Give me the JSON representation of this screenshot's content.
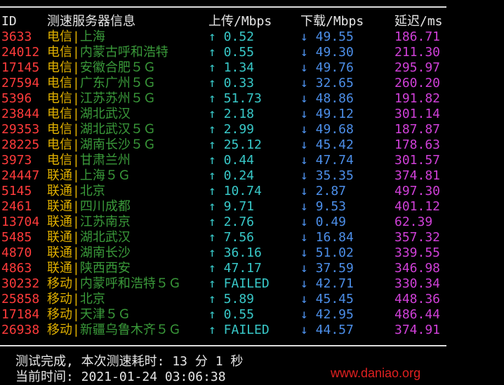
{
  "header": {
    "id": "ID",
    "server": "测速服务器信息",
    "upload": "上传/Mbps",
    "download": "下载/Mbps",
    "latency": "延迟/ms"
  },
  "rows": [
    {
      "id": "3633",
      "isp": "电信",
      "loc": "上海",
      "up": "↑ 0.52",
      "down": "↓ 49.55",
      "ping": "186.71"
    },
    {
      "id": "24012",
      "isp": "电信",
      "loc": "内蒙古呼和浩特",
      "up": "↑ 0.55",
      "down": "↓ 49.30",
      "ping": "211.30"
    },
    {
      "id": "17145",
      "isp": "电信",
      "loc": "安徽合肥５Ｇ",
      "up": "↑ 1.34",
      "down": "↓ 49.76",
      "ping": "295.97"
    },
    {
      "id": "27594",
      "isp": "电信",
      "loc": "广东广州５Ｇ",
      "up": "↑ 0.33",
      "down": "↓ 32.65",
      "ping": "260.20"
    },
    {
      "id": "5396",
      "isp": "电信",
      "loc": "江苏苏州５Ｇ",
      "up": "↑ 51.73",
      "down": "↓ 48.86",
      "ping": "191.82"
    },
    {
      "id": "23844",
      "isp": "电信",
      "loc": "湖北武汉",
      "up": "↑ 2.18",
      "down": "↓ 49.12",
      "ping": "301.14"
    },
    {
      "id": "29353",
      "isp": "电信",
      "loc": "湖北武汉５Ｇ",
      "up": "↑ 2.99",
      "down": "↓ 49.68",
      "ping": "187.87"
    },
    {
      "id": "28225",
      "isp": "电信",
      "loc": "湖南长沙５Ｇ",
      "up": "↑ 25.12",
      "down": "↓ 45.42",
      "ping": "178.63"
    },
    {
      "id": "3973",
      "isp": "电信",
      "loc": "甘肃兰州",
      "up": "↑ 0.44",
      "down": "↓ 47.74",
      "ping": "301.57"
    },
    {
      "id": "24447",
      "isp": "联通",
      "loc": "上海５Ｇ",
      "up": "↑ 0.24",
      "down": "↓ 35.35",
      "ping": "374.81"
    },
    {
      "id": "5145",
      "isp": "联通",
      "loc": "北京",
      "up": "↑ 10.74",
      "down": "↓ 2.87",
      "ping": "497.30"
    },
    {
      "id": "2461",
      "isp": "联通",
      "loc": "四川成都",
      "up": "↑ 9.71",
      "down": "↓ 9.53",
      "ping": "401.12"
    },
    {
      "id": "13704",
      "isp": "联通",
      "loc": "江苏南京",
      "up": "↑ 2.76",
      "down": "↓ 0.49",
      "ping": "62.39"
    },
    {
      "id": "5485",
      "isp": "联通",
      "loc": "湖北武汉",
      "up": "↑ 7.56",
      "down": "↓ 16.84",
      "ping": "357.32"
    },
    {
      "id": "4870",
      "isp": "联通",
      "loc": "湖南长沙",
      "up": "↑ 36.16",
      "down": "↓ 51.02",
      "ping": "339.55"
    },
    {
      "id": "4863",
      "isp": "联通",
      "loc": "陕西西安",
      "up": "↑ 47.17",
      "down": "↓ 37.59",
      "ping": "346.98"
    },
    {
      "id": "30232",
      "isp": "移动",
      "loc": "内蒙呼和浩特５Ｇ",
      "up": "↑ FAILED",
      "down": "↓ 42.71",
      "ping": "330.34"
    },
    {
      "id": "25858",
      "isp": "移动",
      "loc": "北京",
      "up": "↑ 5.89",
      "down": "↓ 45.45",
      "ping": "448.36"
    },
    {
      "id": "17184",
      "isp": "移动",
      "loc": "天津５Ｇ",
      "up": "↑ 0.55",
      "down": "↓ 42.95",
      "ping": "486.44"
    },
    {
      "id": "26938",
      "isp": "移动",
      "loc": "新疆乌鲁木齐５Ｇ",
      "up": "↑ FAILED",
      "down": "↓ 44.57",
      "ping": "374.91"
    }
  ],
  "separator": "|",
  "footer": {
    "done": "测试完成, 本次测速耗时: 13 分 1 秒",
    "time": "当前时间: 2021-01-24 03:06:38"
  },
  "watermark": "www.daniao.org",
  "colors": {
    "id": "#ff3b3b",
    "isp": "#e0b000",
    "location": "#3a9a3a",
    "upload": "#38c8c8",
    "download": "#4c8ee8",
    "latency": "#d040d8",
    "watermark": "#e02020"
  }
}
